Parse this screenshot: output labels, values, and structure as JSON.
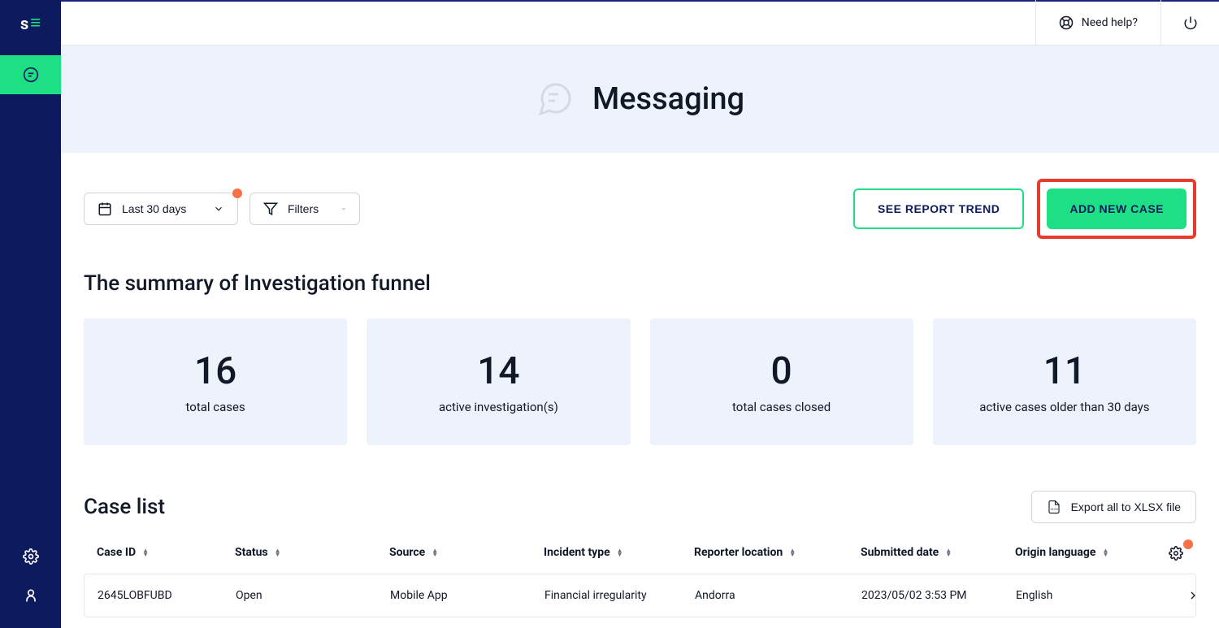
{
  "header": {
    "help_label": "Need help?",
    "page_title": "Messaging"
  },
  "toolbar": {
    "date_label": "Last 30 days",
    "filters_label": "Filters",
    "see_report_label": "SEE REPORT TREND",
    "add_case_label": "ADD NEW CASE"
  },
  "summary": {
    "title": "The summary of Investigation funnel",
    "cards": [
      {
        "value": "16",
        "label": "total cases"
      },
      {
        "value": "14",
        "label": "active investigation(s)"
      },
      {
        "value": "0",
        "label": "total cases closed"
      },
      {
        "value": "11",
        "label": "active cases older than 30 days"
      }
    ]
  },
  "caselist": {
    "title": "Case list",
    "export_label": "Export all to XLSX file",
    "columns": [
      "Case ID",
      "Status",
      "Source",
      "Incident type",
      "Reporter location",
      "Submitted date",
      "Origin language"
    ],
    "rows": [
      {
        "case_id": "2645LOBFUBD",
        "status": "Open",
        "source": "Mobile App",
        "incident_type": "Financial irregularity",
        "reporter_location": "Andorra",
        "submitted_date": "2023/05/02 3:53 PM",
        "origin_language": "English"
      }
    ]
  }
}
